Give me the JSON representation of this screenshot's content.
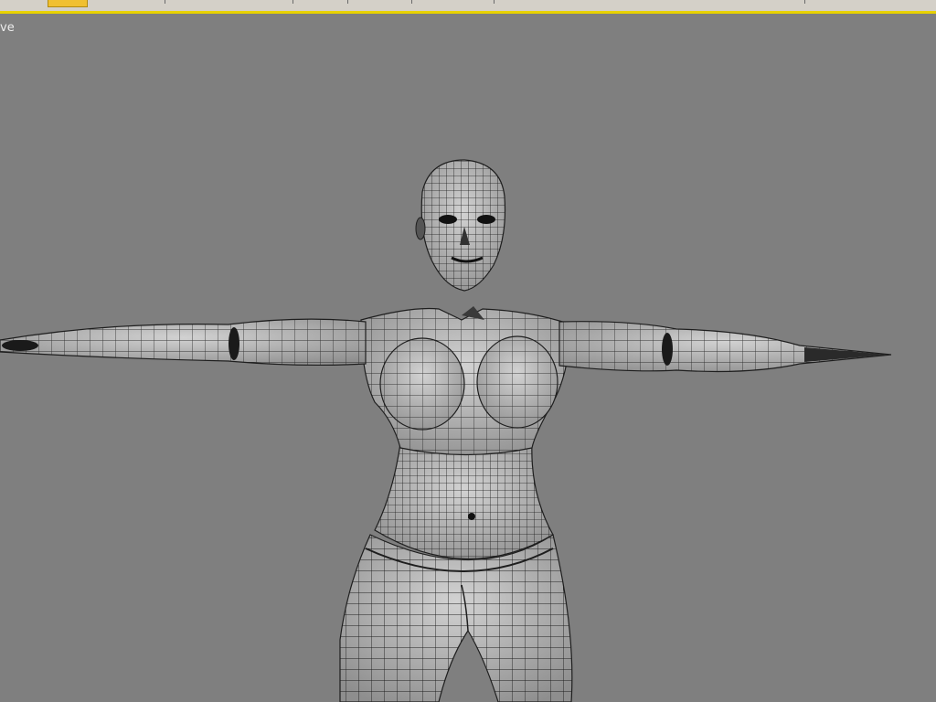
{
  "viewport": {
    "label": "ve",
    "background": "#7f7f7f",
    "active_border_color": "#e8d200"
  },
  "toolbar": {
    "active_tab_color": "#f0c030"
  },
  "model": {
    "shading": "wireframe-on-smooth",
    "mesh_color": "#b9b9b9",
    "wire_color": "#1e1e1e",
    "icon": "wireframe-mesh-icon"
  }
}
